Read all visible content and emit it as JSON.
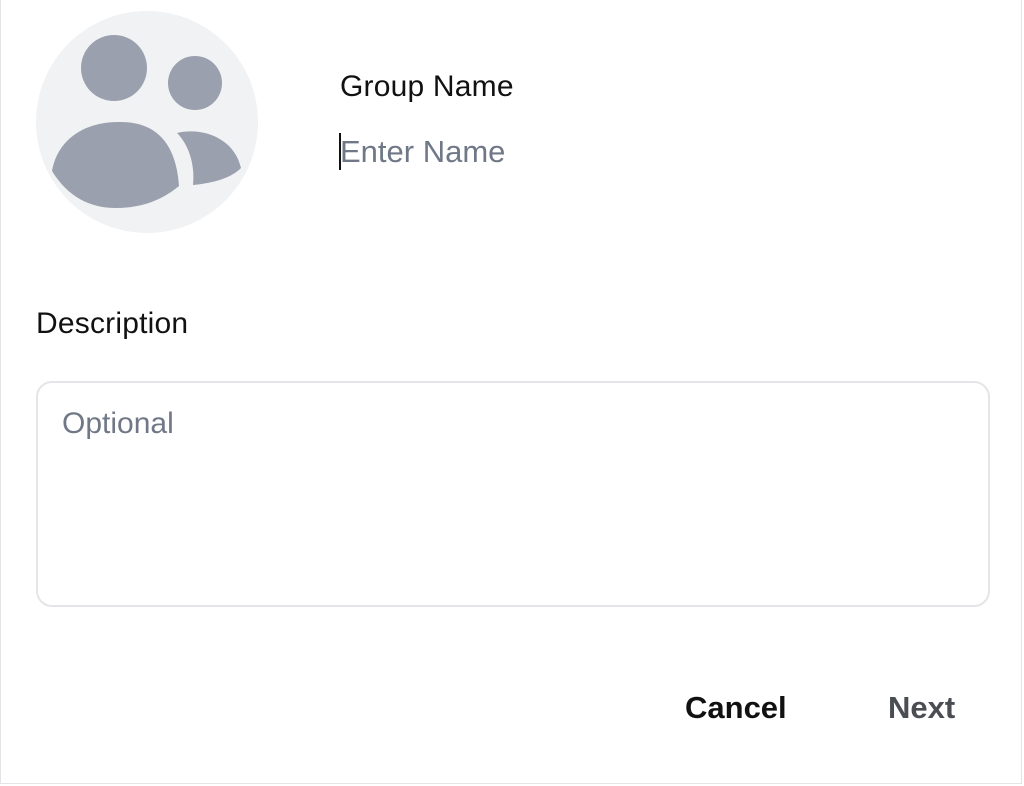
{
  "group_form": {
    "name_label": "Group Name",
    "name_placeholder": "Enter Name",
    "name_value": "",
    "description_label": "Description",
    "description_placeholder": "Optional",
    "description_value": ""
  },
  "avatar": {
    "icon": "group-icon",
    "background_color": "#f1f2f4",
    "icon_color": "#9aa0ad"
  },
  "actions": {
    "cancel_label": "Cancel",
    "next_label": "Next"
  },
  "colors": {
    "placeholder": "#707887",
    "next_disabled": "#4a4d52"
  }
}
